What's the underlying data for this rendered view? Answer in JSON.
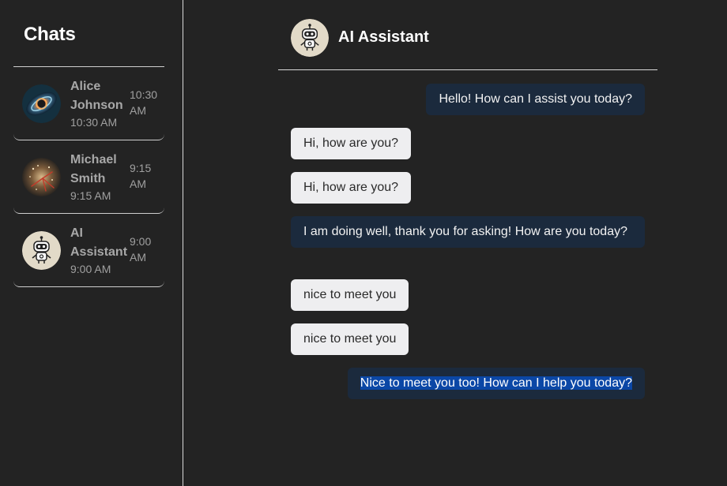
{
  "sidebar": {
    "title": "Chats",
    "chats": [
      {
        "name": "Alice Johnson",
        "subtime": "10:30 AM",
        "time": "10:30 AM",
        "avatar": "galaxy-avatar"
      },
      {
        "name": "Michael Smith",
        "subtime": "9:15 AM",
        "time": "9:15 AM",
        "avatar": "fireworks-avatar"
      },
      {
        "name": "AI Assistant",
        "subtime": "9:00 AM",
        "time": "9:00 AM",
        "avatar": "robot-avatar"
      }
    ]
  },
  "header": {
    "title": "AI Assistant",
    "avatar": "robot-avatar"
  },
  "messages": [
    {
      "sender": "ai",
      "text": "Hello! How can I assist you today?"
    },
    {
      "sender": "user",
      "text": "Hi, how are you?"
    },
    {
      "sender": "user",
      "text": "Hi, how are you?"
    },
    {
      "sender": "ai",
      "text": "I am doing well, thank you for asking! How are you today?"
    },
    {
      "sender": "user",
      "text": "nice to meet you"
    },
    {
      "sender": "user",
      "text": "nice to meet you"
    },
    {
      "sender": "ai",
      "text": "Nice to meet you too! How can I help you today?",
      "selected": true
    }
  ],
  "colors": {
    "background": "#232323",
    "ai_bubble": "#1b2a3d",
    "user_bubble": "#eeeef0",
    "selection": "#0b47a6"
  }
}
